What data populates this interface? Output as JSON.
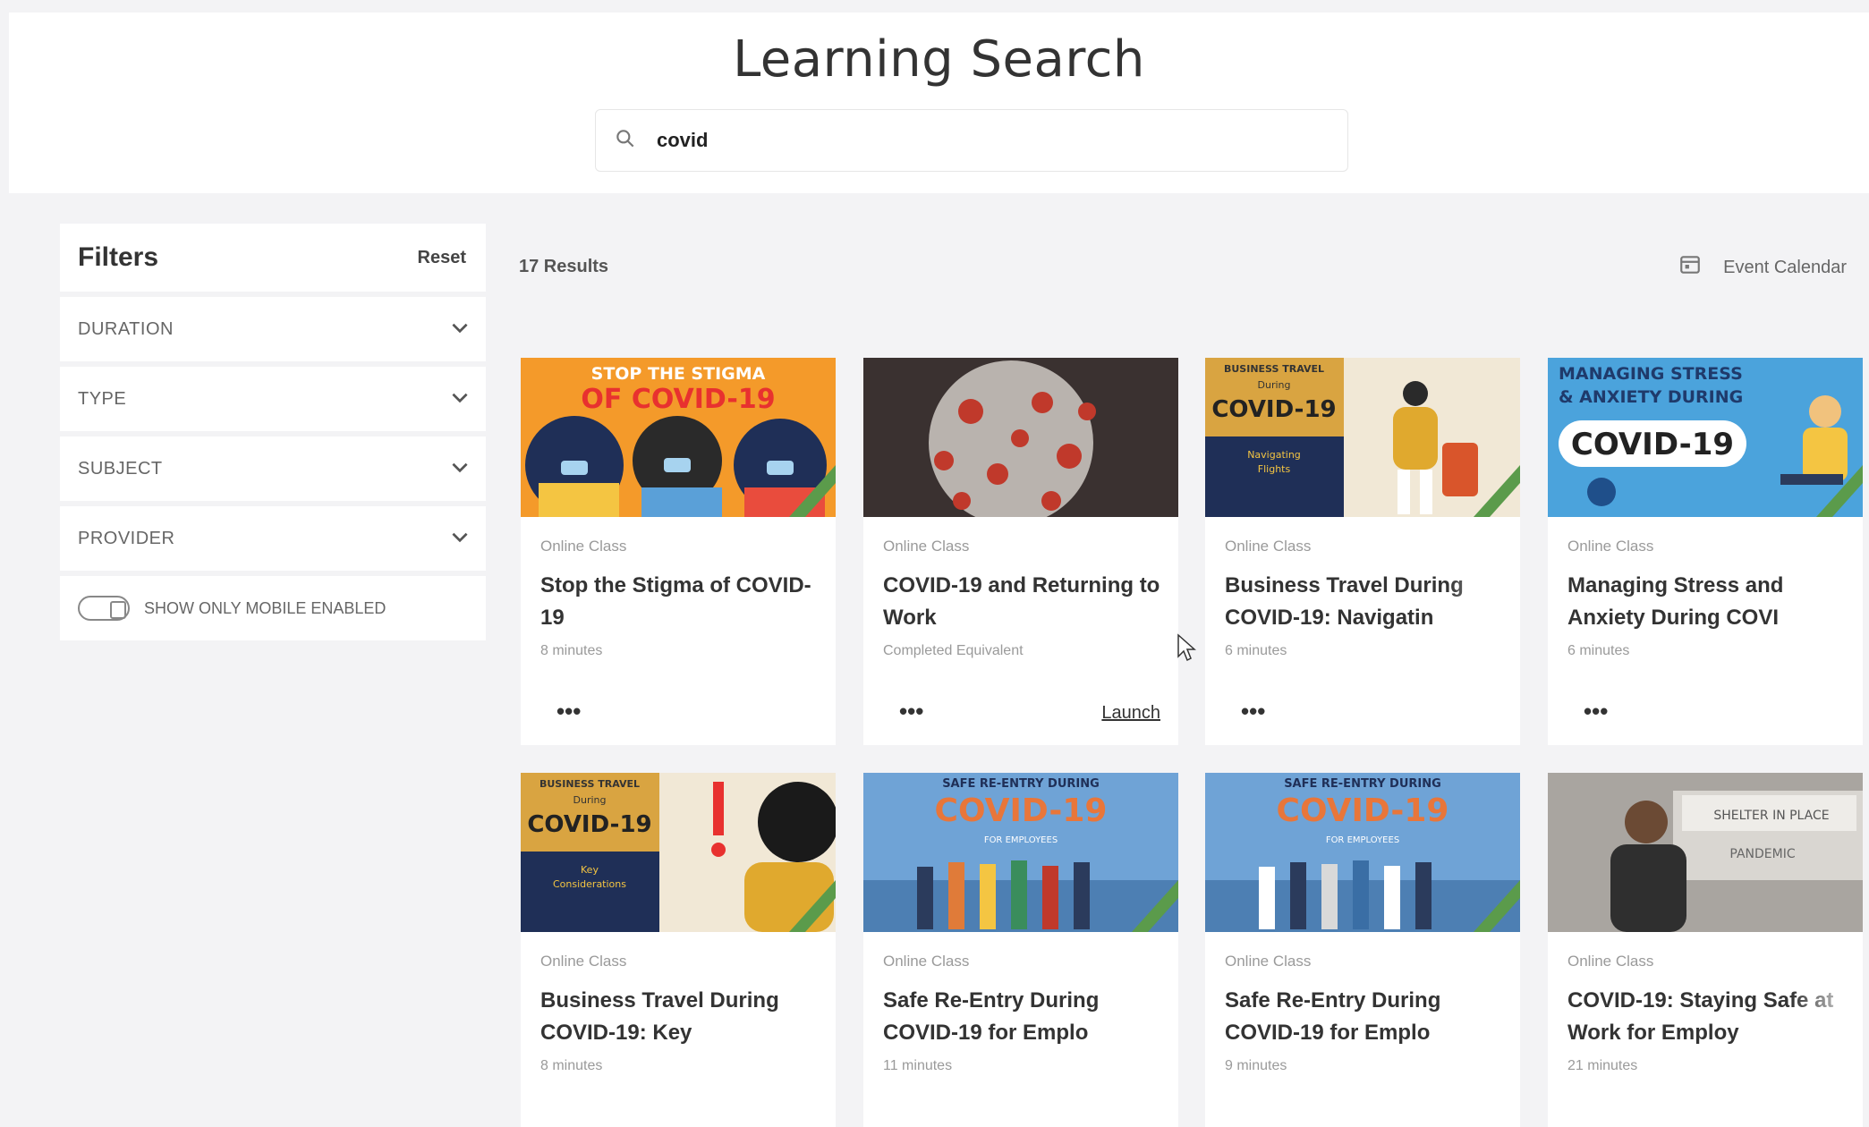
{
  "header": {
    "title": "Learning Search"
  },
  "search": {
    "value": "covid",
    "icon": "search-icon"
  },
  "filters": {
    "title": "Filters",
    "reset_label": "Reset",
    "items": [
      {
        "label": "DURATION"
      },
      {
        "label": "TYPE"
      },
      {
        "label": "SUBJECT"
      },
      {
        "label": "PROVIDER"
      }
    ],
    "mobile_toggle": {
      "label": "SHOW ONLY MOBILE ENABLED",
      "on": false
    }
  },
  "results": {
    "count_label": "17 Results",
    "event_calendar_label": "Event Calendar"
  },
  "cards": [
    {
      "type": "Online Class",
      "title": "Stop the Stigma of COVID-19",
      "duration": "8 minutes",
      "more": "•••",
      "thumb_text": [
        "STOP THE STIGMA",
        "OF COVID-19"
      ]
    },
    {
      "type": "Online Class",
      "title": "COVID-19 and Returning to Work",
      "duration": "Completed Equivalent",
      "more": "•••",
      "launch": "Launch"
    },
    {
      "type": "Online Class",
      "title": "Business Travel During COVID-19: Navigatin",
      "duration": "6 minutes",
      "more": "•••",
      "thumb_text": [
        "BUSINESS TRAVEL",
        "During",
        "COVID-19",
        "Navigating",
        "Flights"
      ]
    },
    {
      "type": "Online Class",
      "title": "Managing Stress and Anxiety During COVI",
      "duration": "6 minutes",
      "more": "•••",
      "thumb_text": [
        "MANAGING STRESS",
        "& ANXIETY DURING",
        "COVID-19"
      ]
    },
    {
      "type": "Online Class",
      "title": "Business Travel During COVID-19: Key",
      "duration": "8 minutes",
      "thumb_text": [
        "BUSINESS TRAVEL",
        "During",
        "COVID-19",
        "Key",
        "Considerations"
      ]
    },
    {
      "type": "Online Class",
      "title": "Safe Re-Entry During COVID-19 for Emplo",
      "duration": "11 minutes",
      "thumb_text": [
        "SAFE RE-ENTRY DURING",
        "COVID-19",
        "FOR EMPLOYEES"
      ]
    },
    {
      "type": "Online Class",
      "title": "Safe Re-Entry During COVID-19 for Emplo",
      "duration": "9 minutes",
      "thumb_text": [
        "SAFE RE-ENTRY DURING",
        "COVID-19",
        "FOR EMPLOYEES"
      ]
    },
    {
      "type": "Online Class",
      "title": "COVID-19: Staying Safe at Work for Employ",
      "duration": "21 minutes",
      "thumb_text": [
        "SHELTER IN PLACE",
        "PANDEMIC"
      ]
    }
  ]
}
